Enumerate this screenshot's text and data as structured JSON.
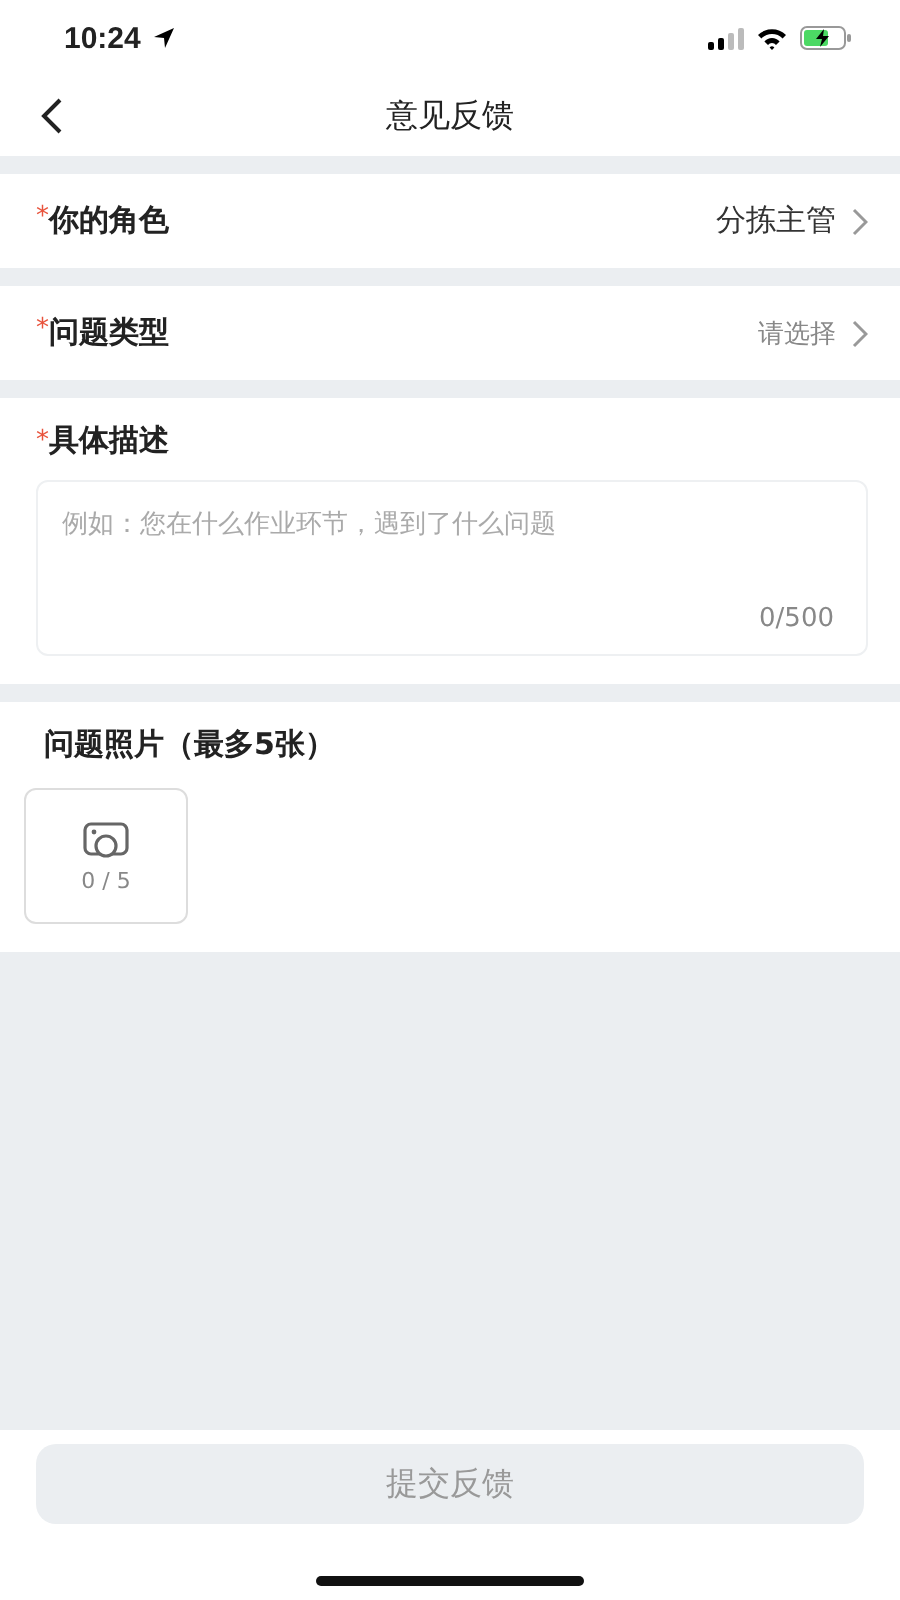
{
  "status_bar": {
    "time": "10:24"
  },
  "nav": {
    "title": "意见反馈"
  },
  "fields": [
    {
      "required_mark": "*",
      "label": "你的角色",
      "value": "分拣主管"
    },
    {
      "required_mark": "*",
      "label": "问题类型",
      "placeholder": "请选择"
    }
  ],
  "description": {
    "required_mark": "*",
    "label": "具体描述",
    "placeholder": "例如：您在什么作业环节，遇到了什么问题",
    "counter": "0/500"
  },
  "photos": {
    "label": "问题照片（最多5张）",
    "count": "0 / 5"
  },
  "submit": {
    "label": "提交反馈",
    "disabled": true
  }
}
